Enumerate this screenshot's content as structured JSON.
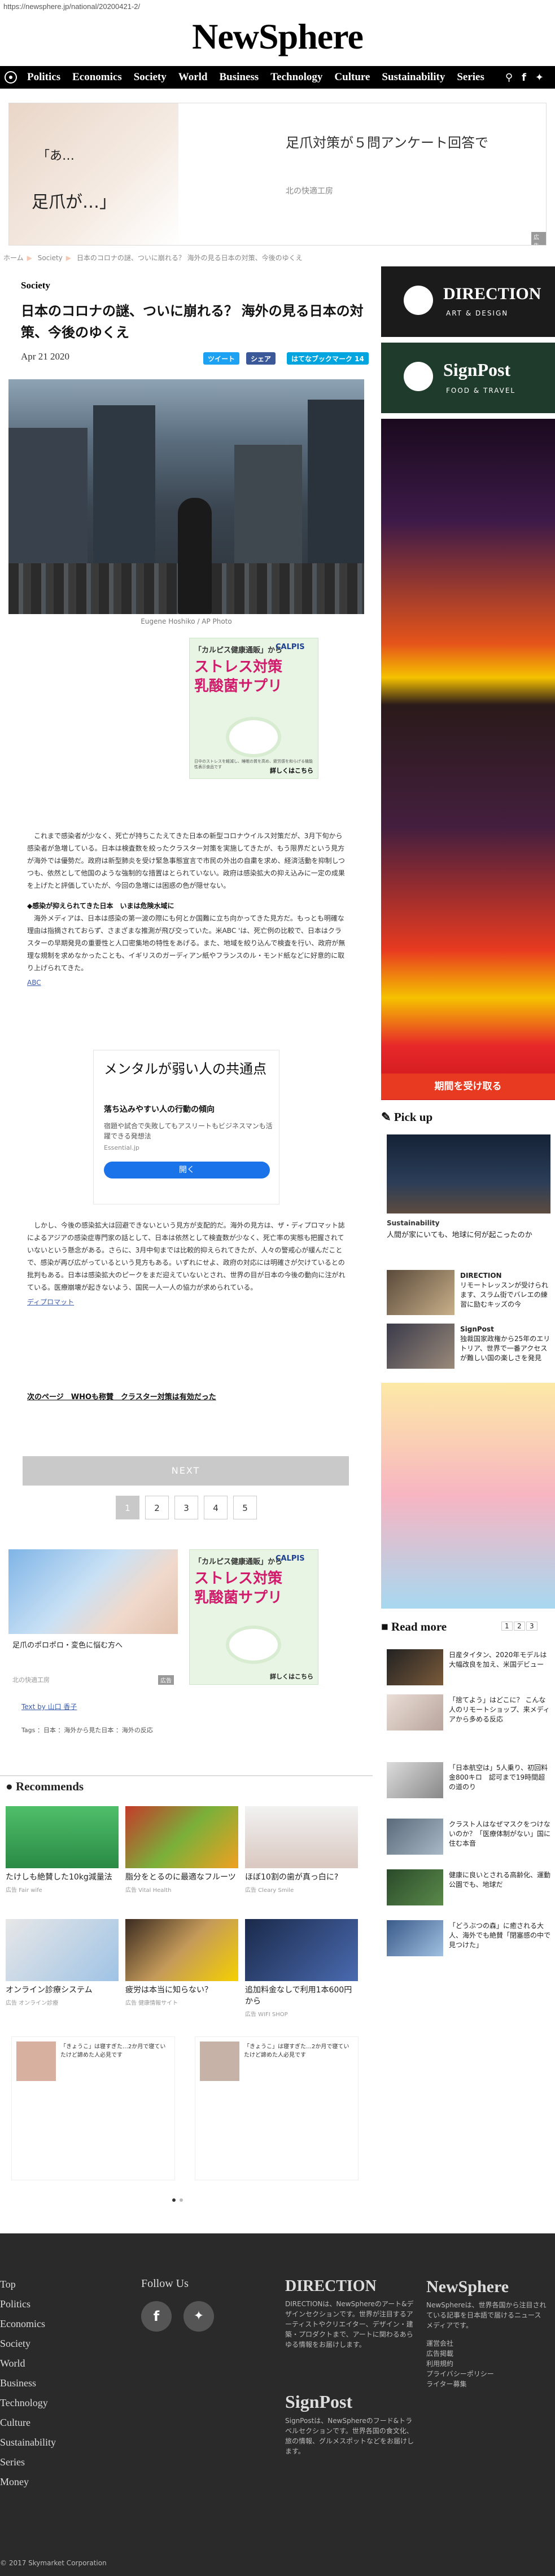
{
  "browser": {
    "url": "https://newsphere.jp/national/20200421-2/"
  },
  "site": {
    "logo": "NewSphere"
  },
  "nav": {
    "categories": [
      "Politics",
      "Economics",
      "Society",
      "World",
      "Business",
      "Technology",
      "Culture",
      "Sustainability",
      "Series"
    ]
  },
  "ad_top": {
    "headline": "足爪対策が５問アンケート回答で",
    "advertiser": "北の快適工房",
    "quote1": "「あ…",
    "quote2": "足爪が…」",
    "badge": "広告"
  },
  "breadcrumb": [
    "ホーム",
    "Society",
    "日本のコロナの謎、ついに崩れる？ 海外の見る日本の対策、今後のゆくえ"
  ],
  "article": {
    "section": "Society",
    "title": "日本のコロナの謎、ついに崩れる？ 海外の見る日本の対策、今後のゆくえ",
    "date": "Apr 21 2020",
    "share": {
      "tweet": "ツイート",
      "fb": "シェア",
      "hatena": "はてなブックマーク 14"
    },
    "photo_caption": "Eugene Hoshiko / AP Photo",
    "p1": "　これまで感染者が少なく、死亡が持ちこたえてきた日本の新型コロナウイルス対策だが、3月下旬から感染者が急増している。日本は検査数を絞ったクラスター対策を実施してきたが、もう限界だという見方が海外では優勢だ。政府は新型肺炎を受け緊急事態宣言で市民の外出の自粛を求め、経済活動を抑制しつつも、依然として他国のような強制的な措置はとられていない。政府は感染拡大の抑え込みに一定の成果を上げたと評価していたが、今回の急増には困惑の色が隠せない。",
    "h1": "◆感染が抑えられてきた日本　いまは危険水域に",
    "p2": "　海外メディアは、日本は感染の第一波の際にも何とか国難に立ち向かってきた見方だ。もっとも明確な理由は指摘されておらず、さまざまな推測が飛び交っていた。米ABC 'は、死亡例の比較で、日本はクラスターの早期発見の重要性と人口密集地の特性をあげる。また、地域を絞り込んで検査を行い、政府が無理な規制を求めなかったことも、イギリスのガーディアン紙やフランスのル・モンド紙などに好意的に取り上げられてきた。",
    "link1": "ABC",
    "ad_mid": {
      "title": "メンタルが弱い人の共通点",
      "sub": "落ち込みやすい人の行動の傾向",
      "desc": "宿題や試合で失敗してもアスリートもビジネスマンも活躍できる発想法",
      "domain": "Essential.jp",
      "btn": "開く"
    },
    "p3": "　しかし、今後の感染拡大は回避できないという見方が支配的だ。海外の見方は、ザ・ディプロマット誌によるアジアの感染症専門家の話として、日本は依然として検査数が少なく、死亡率の実態も把握されていないという懸念がある。さらに、3月中旬までは比較的抑えられてきたが、人々の警戒心が緩んだことで、感染が再び広がっているという見方もある。いずれにせよ、政府の対応には明確さが欠けているとの批判もある。日本は感染拡大のピークをまだ迎えていないとされ、世界の目が日本の今後の動向に注がれている。医療崩壊が起きないよう、国民一人一人の協力が求められている。",
    "link2": "ディプロマット",
    "next_link": "次のページ　WHOも称賛　クラスター対策は有効だった",
    "next_btn": "NEXT",
    "pages": [
      "1",
      "2",
      "3",
      "4",
      "5"
    ],
    "ad_bottom": {
      "title": "足爪のポロポロ・変色に悩む方へ",
      "advertiser": "北の快適工房",
      "badge": "広告"
    },
    "author": "Text by 山口 香子",
    "tags": "Tags ：日本 ：海外から見た日本 ：海外の反応"
  },
  "calpis": {
    "top": "「カルピス健康通販」から",
    "big": "ストレス対策\n乳酸菌サプリ",
    "brand": "CALPIS",
    "fine": "日中のストレスを軽減し、睡眠の質を高め、疲労感を和らげる機能性表示食品です",
    "btn": "詳しくはこちら"
  },
  "recommends": {
    "heading": "Recommends",
    "items": [
      {
        "title": "たけしも絶賛した10kg減量法",
        "src": "広告 Fair wife"
      },
      {
        "title": "脂分をとるのに最適なフルーツ",
        "src": "広告 Vital Health"
      },
      {
        "title": "ほぼ10割の歯が真っ白に?",
        "src": "広告 Cleary Smile"
      },
      {
        "title": "オンライン診療システム",
        "src": "広告 オンライン診療"
      },
      {
        "title": "疲労は本当に知らない？",
        "src": "広告 健康情報サイト"
      },
      {
        "title": "追加料金なしで利用1本600円から",
        "src": "広告 WIFI SHOP"
      }
    ],
    "minis": [
      "「きょうこ」は寝すぎた…2か月で寝ていたけど諦めた人必見です",
      "「きょうこ」は寝すぎた…2か月で寝ていたけど諦めた人必見です"
    ]
  },
  "sidebar": {
    "direction": {
      "name": "DIRECTION",
      "sub": "ART & DESIGN"
    },
    "signpost": {
      "name": "SignPost",
      "sub": "FOOD & TRAVEL"
    },
    "ad_btn": "期間を受け取る",
    "pickup": {
      "heading": "Pick up",
      "big_section": "Sustainability",
      "big_title": "人間が家にいても、地球に何が起こったのか",
      "items": [
        {
          "brand": "DIRECTION",
          "title": "リモートレッスンが受けられます、スラム街でバレエの練習に励むキッズの今"
        },
        {
          "brand": "SignPost",
          "title": "独裁国家政権から25年のエリトリア、世界で一番アクセスが難しい国の楽しさを発見"
        }
      ]
    },
    "readmore": {
      "heading": "Read more",
      "pages": [
        "1",
        "2",
        "3"
      ],
      "items": [
        "日産タイタン、2020年モデルは大幅改良を加え、米国デビュー",
        "「捨てよう」はどこに？ こんな人のリモートショップ、来メディアから多める反応",
        "「日本航空は」5人乗り、初回料金800キロ　認可まで19時間超の道のり",
        "クラスト人はなぜマスクをつけないのか？「医療体制がない」国に住む本音",
        "健康に良いとされる高齢化、運動公園でも、地球だ",
        "「どうぶつの森」に癒される大人、海外でも絶賛「閉塞感の中で見つけた」"
      ]
    }
  },
  "footer": {
    "categories": [
      "Top",
      "Politics",
      "Economics",
      "Society",
      "World",
      "Business",
      "Technology",
      "Culture",
      "Sustainability",
      "Series",
      "Money"
    ],
    "follow": "Follow Us",
    "direction": {
      "name": "DIRECTION",
      "desc": "DIRECTIONは、NewSphereのアート&デザインセクションです。世界が注目するアーティストやクリエイター、デザイン・建築・プロダクトまで、アートに関わるあらゆる情報をお届けします。"
    },
    "signpost": {
      "name": "SignPost",
      "desc": "SignPostは、NewSphereのフード&トラベルセクションです。世界各国の食文化、旅の情報、グルメスポットなどをお届けします。"
    },
    "newsphere": {
      "name": "NewSphere",
      "desc": "NewSphereは、世界各国から注目されている記事を日本語で届けるニュースメディアです。",
      "links": [
        "運営会社",
        "広告掲載",
        "利用規約",
        "プライバシーポリシー",
        "ライター募集"
      ]
    },
    "copyright": "© 2017 Skymarket Corporation"
  }
}
